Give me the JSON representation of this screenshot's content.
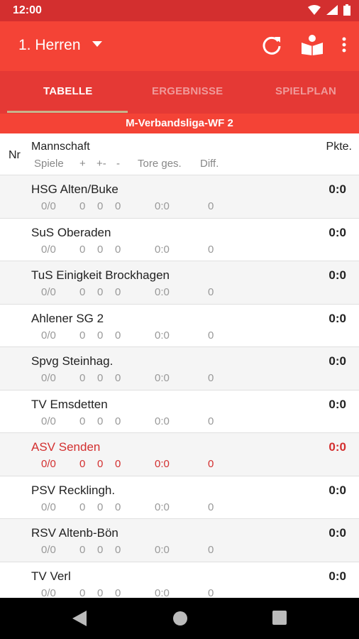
{
  "status": {
    "time": "12:00"
  },
  "appbar": {
    "title": "1. Herren"
  },
  "tabs": [
    "TABELLE",
    "ERGEBNISSE",
    "SPIELPLAN"
  ],
  "league": "M-Verbandsliga-WF 2",
  "table_header": {
    "nr": "Nr",
    "team": "Mannschaft",
    "points": "Pkte.",
    "games": "Spiele",
    "plus": "+",
    "draw": "+-",
    "minus": "-",
    "goals": "Tore ges.",
    "diff": "Diff."
  },
  "rows": [
    {
      "name": "HSG Alten/Buke",
      "games": "0/0",
      "w": "0",
      "d": "0",
      "l": "0",
      "goals": "0:0",
      "diff": "0",
      "pts": "0:0"
    },
    {
      "name": "SuS Oberaden",
      "games": "0/0",
      "w": "0",
      "d": "0",
      "l": "0",
      "goals": "0:0",
      "diff": "0",
      "pts": "0:0"
    },
    {
      "name": "TuS Einigkeit Brockhagen",
      "games": "0/0",
      "w": "0",
      "d": "0",
      "l": "0",
      "goals": "0:0",
      "diff": "0",
      "pts": "0:0"
    },
    {
      "name": "Ahlener SG 2",
      "games": "0/0",
      "w": "0",
      "d": "0",
      "l": "0",
      "goals": "0:0",
      "diff": "0",
      "pts": "0:0"
    },
    {
      "name": "Spvg Steinhag.",
      "games": "0/0",
      "w": "0",
      "d": "0",
      "l": "0",
      "goals": "0:0",
      "diff": "0",
      "pts": "0:0"
    },
    {
      "name": "TV Emsdetten",
      "games": "0/0",
      "w": "0",
      "d": "0",
      "l": "0",
      "goals": "0:0",
      "diff": "0",
      "pts": "0:0"
    },
    {
      "name": "ASV Senden",
      "games": "0/0",
      "w": "0",
      "d": "0",
      "l": "0",
      "goals": "0:0",
      "diff": "0",
      "pts": "0:0",
      "highlight": true
    },
    {
      "name": "PSV Recklingh.",
      "games": "0/0",
      "w": "0",
      "d": "0",
      "l": "0",
      "goals": "0:0",
      "diff": "0",
      "pts": "0:0"
    },
    {
      "name": "RSV Altenb-Bön",
      "games": "0/0",
      "w": "0",
      "d": "0",
      "l": "0",
      "goals": "0:0",
      "diff": "0",
      "pts": "0:0"
    },
    {
      "name": "TV Verl",
      "games": "0/0",
      "w": "0",
      "d": "0",
      "l": "0",
      "goals": "0:0",
      "diff": "0",
      "pts": "0:0"
    }
  ],
  "colors": {
    "primary": "#f44336",
    "primary_dark": "#d32f2f",
    "highlight_text": "#d32f2f"
  },
  "icons": [
    "wifi-icon",
    "signal-icon",
    "battery-icon",
    "dropdown-arrow-icon",
    "refresh-icon",
    "book-reader-icon",
    "more-vert-icon",
    "back-icon",
    "home-icon",
    "recents-icon"
  ]
}
